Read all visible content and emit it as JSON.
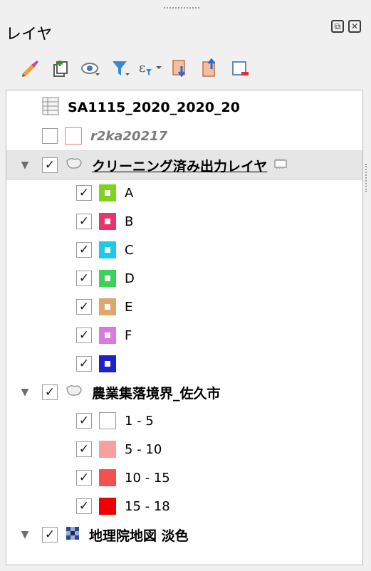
{
  "panel": {
    "title": "レイヤ",
    "float_button": "⧉",
    "close_button": "✕"
  },
  "toolbar": {
    "icons": [
      "style-brush-icon",
      "add-group-icon",
      "visibility-eye-icon",
      "filter-icon",
      "expression-filter-icon",
      "expand-all-icon",
      "collapse-all-icon",
      "remove-layer-icon"
    ]
  },
  "tree": {
    "table_layer": {
      "label": "SA1115_2020_2020_20"
    },
    "r2ka_layer": {
      "label": "r2ka20217"
    },
    "cleaning_layer": {
      "label": "クリーニング済み出力レイヤ",
      "categories": [
        {
          "label": "A",
          "color": "#7ed321"
        },
        {
          "label": "B",
          "color": "#e8336b"
        },
        {
          "label": "C",
          "color": "#1ec8e8"
        },
        {
          "label": "D",
          "color": "#3ed15a"
        },
        {
          "label": "E",
          "color": "#e0a66a"
        },
        {
          "label": "F",
          "color": "#d77be0"
        },
        {
          "label": "",
          "color": "#1e22c8"
        }
      ]
    },
    "boundary_layer": {
      "label": "農業集落境界_佐久市",
      "classes": [
        {
          "label": "1 - 5",
          "color": "#ffffff"
        },
        {
          "label": "5 - 10",
          "color": "#f7a0a0"
        },
        {
          "label": "10 - 15",
          "color": "#f55050"
        },
        {
          "label": "15 - 18",
          "color": "#f00000"
        }
      ]
    },
    "basemap_layer": {
      "label": "地理院地図 淡色"
    }
  }
}
